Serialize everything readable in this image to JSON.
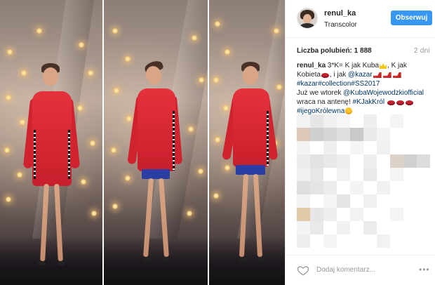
{
  "post": {
    "username": "renul_ka",
    "location": "Transcolor",
    "follow_label": "Obserwuj",
    "likes_label": "Liczba polubień: 1 888",
    "time_ago": "2 dni"
  },
  "caption": {
    "username": "renul_ka",
    "t1": " 3*K= K jak Kuba",
    "t2": ", K jak Kobieta",
    "t3": ", i jak ",
    "mention_kazar": "@kazar",
    "tag_kazar": "#kazar",
    "tag_collection": "#collection",
    "tag_ss": "#SS2017",
    "t4": "Już we wtorek ",
    "mention_kuba": "@KubaWojewodzkiofficial",
    "t5": " wraca na antenę! ",
    "tag_kjakkrol": "#KJakKról",
    "tag_krolewna": "#ijegoKrólewna"
  },
  "icons": {
    "heart": "heart-outline-icon",
    "more": "more-options-icon",
    "crown": "crown-emoji",
    "lips": "lips-emoji",
    "shoe": "high-heel-emoji",
    "face": "grinning-face-emoji"
  },
  "footer": {
    "add_comment_placeholder": "Dodaj komentarz...",
    "more_label": "•••"
  },
  "colors": {
    "accent": "#3897f0",
    "link": "#003569",
    "muted": "#999999",
    "dress": "#d8262f",
    "skirt": "#2b3ea3"
  }
}
